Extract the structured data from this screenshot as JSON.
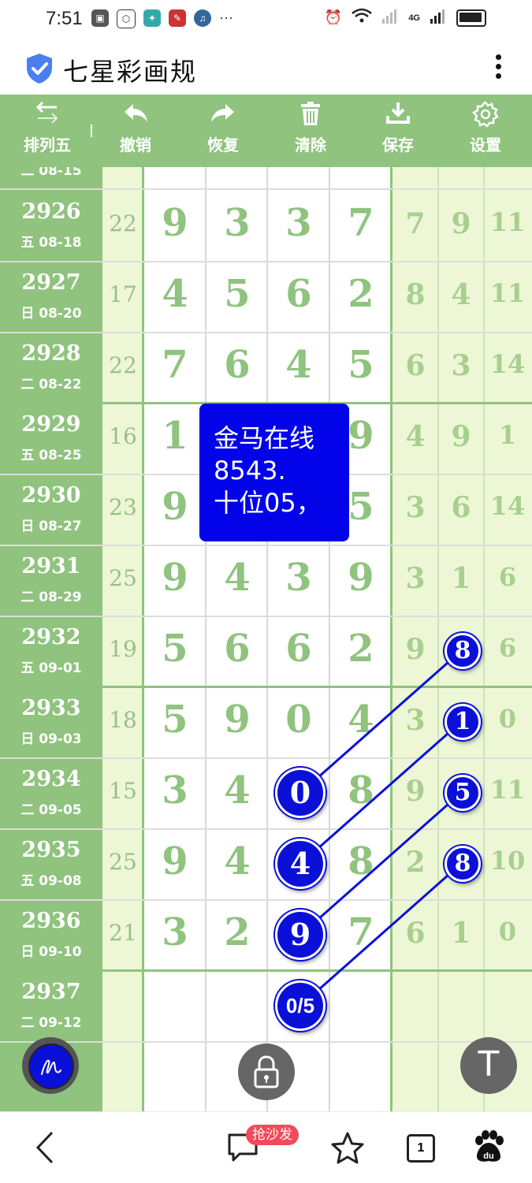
{
  "status_bar": {
    "time": "7:51",
    "network": "4G",
    "more": "···"
  },
  "title_bar": {
    "title": "七星彩画规"
  },
  "toolbar": {
    "items": [
      {
        "label": "排列五",
        "icon": "swap-arrows-icon"
      },
      {
        "label": "撤销",
        "icon": "undo-icon"
      },
      {
        "label": "恢复",
        "icon": "redo-icon"
      },
      {
        "label": "清除",
        "icon": "trash-icon"
      },
      {
        "label": "保存",
        "icon": "download-icon"
      },
      {
        "label": "设置",
        "icon": "gear-icon"
      }
    ]
  },
  "grid": {
    "partial_top_date": "二 08-15",
    "rows": [
      {
        "issue": "2926",
        "date": "五 08-18",
        "sum": "22",
        "digits": [
          "9",
          "3",
          "3",
          "7"
        ],
        "right": [
          "7",
          "9",
          "11"
        ]
      },
      {
        "issue": "2927",
        "date": "日 08-20",
        "sum": "17",
        "digits": [
          "4",
          "5",
          "6",
          "2"
        ],
        "right": [
          "8",
          "4",
          "11"
        ]
      },
      {
        "issue": "2928",
        "date": "二 08-22",
        "sum": "22",
        "digits": [
          "7",
          "6",
          "4",
          "5"
        ],
        "right": [
          "6",
          "3",
          "14"
        ]
      },
      {
        "issue": "2929",
        "date": "五 08-25",
        "sum": "16",
        "digits": [
          "1",
          "",
          "",
          "9"
        ],
        "right": [
          "4",
          "9",
          "1"
        ]
      },
      {
        "issue": "2930",
        "date": "日 08-27",
        "sum": "23",
        "digits": [
          "9",
          "",
          "",
          "5"
        ],
        "right": [
          "3",
          "6",
          "14"
        ]
      },
      {
        "issue": "2931",
        "date": "二 08-29",
        "sum": "25",
        "digits": [
          "9",
          "4",
          "3",
          "9"
        ],
        "right": [
          "3",
          "1",
          "6"
        ]
      },
      {
        "issue": "2932",
        "date": "五 09-01",
        "sum": "19",
        "digits": [
          "5",
          "6",
          "6",
          "2"
        ],
        "right": [
          "9",
          "",
          "6"
        ]
      },
      {
        "issue": "2933",
        "date": "日 09-03",
        "sum": "18",
        "digits": [
          "5",
          "9",
          "0",
          "4"
        ],
        "right": [
          "3",
          "",
          "0"
        ]
      },
      {
        "issue": "2934",
        "date": "二 09-05",
        "sum": "15",
        "digits": [
          "3",
          "4",
          "",
          "8"
        ],
        "right": [
          "9",
          "",
          "11"
        ]
      },
      {
        "issue": "2935",
        "date": "五 09-08",
        "sum": "25",
        "digits": [
          "9",
          "4",
          "",
          "8"
        ],
        "right": [
          "2",
          "",
          "10"
        ]
      },
      {
        "issue": "2936",
        "date": "日 09-10",
        "sum": "21",
        "digits": [
          "3",
          "2",
          "",
          "7"
        ],
        "right": [
          "6",
          "1",
          "0"
        ]
      },
      {
        "issue": "2937",
        "date": "二 09-12",
        "sum": "",
        "digits": [
          "",
          "",
          "",
          ""
        ],
        "right": [
          "",
          "",
          ""
        ]
      }
    ]
  },
  "markers": {
    "main": [
      "0",
      "4",
      "9",
      "0/5"
    ],
    "right": [
      "8",
      "1",
      "5",
      "8"
    ]
  },
  "note": {
    "line1": "金马在线",
    "line2": "8543.",
    "line3": "十位05，"
  },
  "fabs": {
    "top_label": "T"
  },
  "bottom_bar": {
    "badge": "抢沙发",
    "tab_count": "1"
  },
  "colors": {
    "green": "#8fc37e",
    "light_green": "#edf7d6",
    "marker_blue": "#0b10d8",
    "note_blue": "#0303e9"
  }
}
